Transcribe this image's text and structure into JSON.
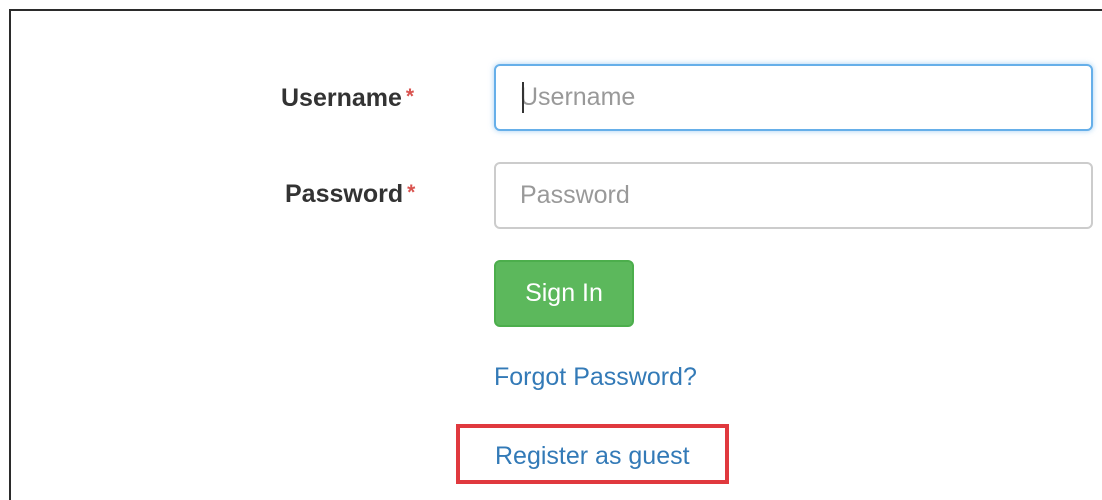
{
  "form": {
    "username": {
      "label": "Username",
      "required_mark": "*",
      "placeholder": "Username",
      "value": ""
    },
    "password": {
      "label": "Password",
      "required_mark": "*",
      "placeholder": "Password",
      "value": ""
    },
    "sign_in_label": "Sign In",
    "forgot_password_label": "Forgot Password?",
    "register_guest_label": "Register as guest"
  },
  "colors": {
    "required": "#d9534f",
    "sign_in_button": "#5cb85c",
    "link": "#337ab7",
    "focus_border": "#66afe9",
    "highlight_box": "#e0393e"
  }
}
